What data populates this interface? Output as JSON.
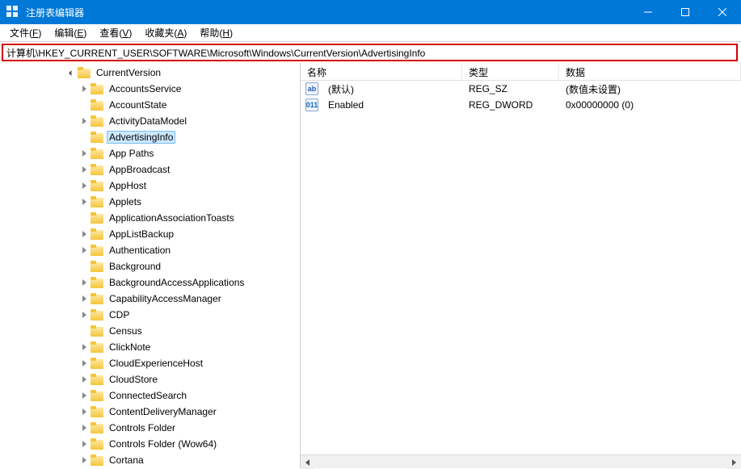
{
  "titlebar": {
    "title": "注册表编辑器"
  },
  "menubar": {
    "items": [
      {
        "label": "文件",
        "hotkey": "F"
      },
      {
        "label": "编辑",
        "hotkey": "E"
      },
      {
        "label": "查看",
        "hotkey": "V"
      },
      {
        "label": "收藏夹",
        "hotkey": "A"
      },
      {
        "label": "帮助",
        "hotkey": "H"
      }
    ]
  },
  "addressbar": {
    "path": "计算机\\HKEY_CURRENT_USER\\SOFTWARE\\Microsoft\\Windows\\CurrentVersion\\AdvertisingInfo"
  },
  "tree": {
    "parent": {
      "label": "CurrentVersion",
      "expanded": true,
      "indent": 5
    },
    "children_indent": 6,
    "selected": "AdvertisingInfo",
    "children": [
      {
        "label": "AccountsService",
        "exp": "closed"
      },
      {
        "label": "AccountState",
        "exp": "none"
      },
      {
        "label": "ActivityDataModel",
        "exp": "closed"
      },
      {
        "label": "AdvertisingInfo",
        "exp": "none"
      },
      {
        "label": "App Paths",
        "exp": "closed"
      },
      {
        "label": "AppBroadcast",
        "exp": "closed"
      },
      {
        "label": "AppHost",
        "exp": "closed"
      },
      {
        "label": "Applets",
        "exp": "closed"
      },
      {
        "label": "ApplicationAssociationToasts",
        "exp": "none"
      },
      {
        "label": "AppListBackup",
        "exp": "closed"
      },
      {
        "label": "Authentication",
        "exp": "closed"
      },
      {
        "label": "Background",
        "exp": "none"
      },
      {
        "label": "BackgroundAccessApplications",
        "exp": "closed"
      },
      {
        "label": "CapabilityAccessManager",
        "exp": "closed"
      },
      {
        "label": "CDP",
        "exp": "closed"
      },
      {
        "label": "Census",
        "exp": "none"
      },
      {
        "label": "ClickNote",
        "exp": "closed"
      },
      {
        "label": "CloudExperienceHost",
        "exp": "closed"
      },
      {
        "label": "CloudStore",
        "exp": "closed"
      },
      {
        "label": "ConnectedSearch",
        "exp": "closed"
      },
      {
        "label": "ContentDeliveryManager",
        "exp": "closed"
      },
      {
        "label": "Controls Folder",
        "exp": "closed"
      },
      {
        "label": "Controls Folder (Wow64)",
        "exp": "closed"
      },
      {
        "label": "Cortana",
        "exp": "closed"
      }
    ]
  },
  "list": {
    "headers": {
      "name": "名称",
      "type": "类型",
      "data": "数据"
    },
    "rows": [
      {
        "icon": "ab",
        "name": "(默认)",
        "type": "REG_SZ",
        "data": "(数值未设置)"
      },
      {
        "icon": "011",
        "name": "Enabled",
        "type": "REG_DWORD",
        "data": "0x00000000 (0)"
      }
    ]
  }
}
